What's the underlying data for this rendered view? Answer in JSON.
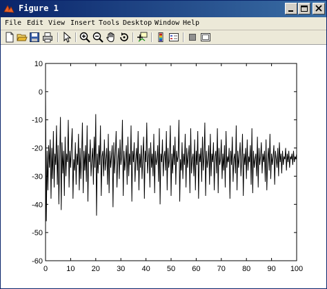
{
  "window": {
    "title": "Figure 1",
    "title_bar_color": "#0a246a"
  },
  "menu": [
    "File",
    "Edit",
    "View",
    "Insert",
    "Tools",
    "Desktop",
    "Window",
    "Help"
  ],
  "toolbar_icons": [
    "new-icon",
    "open-icon",
    "save-icon",
    "print-icon",
    "pointer-icon",
    "zoom-in-icon",
    "zoom-out-icon",
    "pan-icon",
    "rotate-icon",
    "data-cursor-icon",
    "colorbar-icon",
    "legend-icon",
    "hide-plot-tools-icon",
    "show-plot-tools-icon"
  ],
  "chart_data": {
    "type": "line",
    "title": "",
    "xlabel": "",
    "ylabel": "",
    "xlim": [
      0,
      100
    ],
    "ylim": [
      -60,
      10
    ],
    "xticks": [
      0,
      10,
      20,
      30,
      40,
      50,
      60,
      70,
      80,
      90,
      100
    ],
    "yticks": [
      10,
      0,
      -10,
      -20,
      -30,
      -40,
      -50,
      -60
    ],
    "grid": false,
    "line_color": "#000000",
    "series": [
      {
        "values": [
          0,
          -46,
          -21,
          -35,
          -19,
          -27,
          -17,
          -38,
          -20,
          -31,
          -14,
          -34,
          -22,
          -26,
          -12,
          -33,
          -19,
          -40,
          -24,
          -9,
          -42,
          -18,
          -29,
          -21,
          -37,
          -16,
          -30,
          -22,
          -25,
          -10,
          -34,
          -21,
          -27,
          -19,
          -13,
          -38,
          -24,
          -28,
          -18,
          -33,
          -22,
          -26,
          -15,
          -35,
          -20,
          -31,
          -23,
          -11,
          -36,
          -21,
          -28,
          -19,
          -32,
          -12,
          -39,
          -22,
          -25,
          -17,
          -30,
          -24,
          -20,
          -33,
          -16,
          -27,
          -8,
          -44,
          -22,
          -29,
          -19,
          -26,
          -12,
          -37,
          -23,
          -21,
          -30,
          -17,
          -28,
          -24,
          -20,
          -33,
          -15,
          -36,
          -21,
          -27,
          -23,
          -19,
          -41,
          -18,
          -29,
          -22,
          -14,
          -34,
          -25,
          -20,
          -31,
          -17,
          -26,
          -23,
          -10,
          -37,
          -21,
          -28,
          -24,
          -19,
          -33,
          -16,
          -30,
          -22,
          -26,
          -12,
          -39,
          -21,
          -25,
          -18,
          -32,
          -24,
          -20,
          -28,
          -14,
          -35,
          -22,
          -27,
          -19,
          -31,
          -23,
          -16,
          -38,
          -21,
          -25,
          -11,
          -29,
          -24,
          -20,
          -34,
          -18,
          -27,
          -22,
          -30,
          -15,
          -36,
          -21,
          -26,
          -24,
          -19,
          -32,
          -13,
          -40,
          -22,
          -25,
          -17,
          -30,
          -23,
          -21,
          -28,
          -14,
          -35,
          -20,
          -27,
          -24,
          -12,
          -37,
          -22,
          -29,
          -19,
          -26,
          -16,
          -33,
          -21,
          -25,
          -23,
          -10,
          -39,
          -24,
          -28,
          -18,
          -31,
          -22,
          -26,
          -15,
          -34,
          -20,
          -27,
          -23,
          -19,
          -36,
          -13,
          -29,
          -24,
          -22,
          -30,
          -17,
          -35,
          -21,
          -26,
          -14,
          -38,
          -22,
          -25,
          -20,
          -32,
          -16,
          -28,
          -23,
          -11,
          -37,
          -21,
          -27,
          -24,
          -19,
          -33,
          -15,
          -30,
          -22,
          -25,
          -18,
          -35,
          -23,
          -21,
          -29,
          -13,
          -36,
          -20,
          -26,
          -24,
          -17,
          -31,
          -22,
          -28,
          -19,
          -34,
          -14,
          -27,
          -23,
          -25,
          -20,
          -38,
          -21,
          -26,
          -16,
          -32,
          -24,
          -22,
          -29,
          -12,
          -35,
          -21,
          -27,
          -23,
          -18,
          -30,
          -24,
          -15,
          -37,
          -22,
          -26,
          -20,
          -31,
          -17,
          -28,
          -23,
          -25,
          -19,
          -33,
          -13,
          -36,
          -21,
          -27,
          -24,
          -22,
          -30,
          -16,
          -34,
          -20,
          -26,
          -23,
          -18,
          -29,
          -22,
          -25,
          -21,
          -32,
          -17,
          -35,
          -24,
          -20,
          -28,
          -15,
          -31,
          -22,
          -26,
          -23,
          -19,
          -33,
          -21,
          -24,
          -27,
          -20,
          -30,
          -18,
          -25,
          -22,
          -29,
          -21,
          -26,
          -23,
          -24,
          -20,
          -28,
          -22,
          -25,
          -21,
          -27,
          -23,
          -24,
          -22,
          -26,
          -21,
          -25,
          -23,
          -24,
          -22
        ]
      }
    ]
  }
}
